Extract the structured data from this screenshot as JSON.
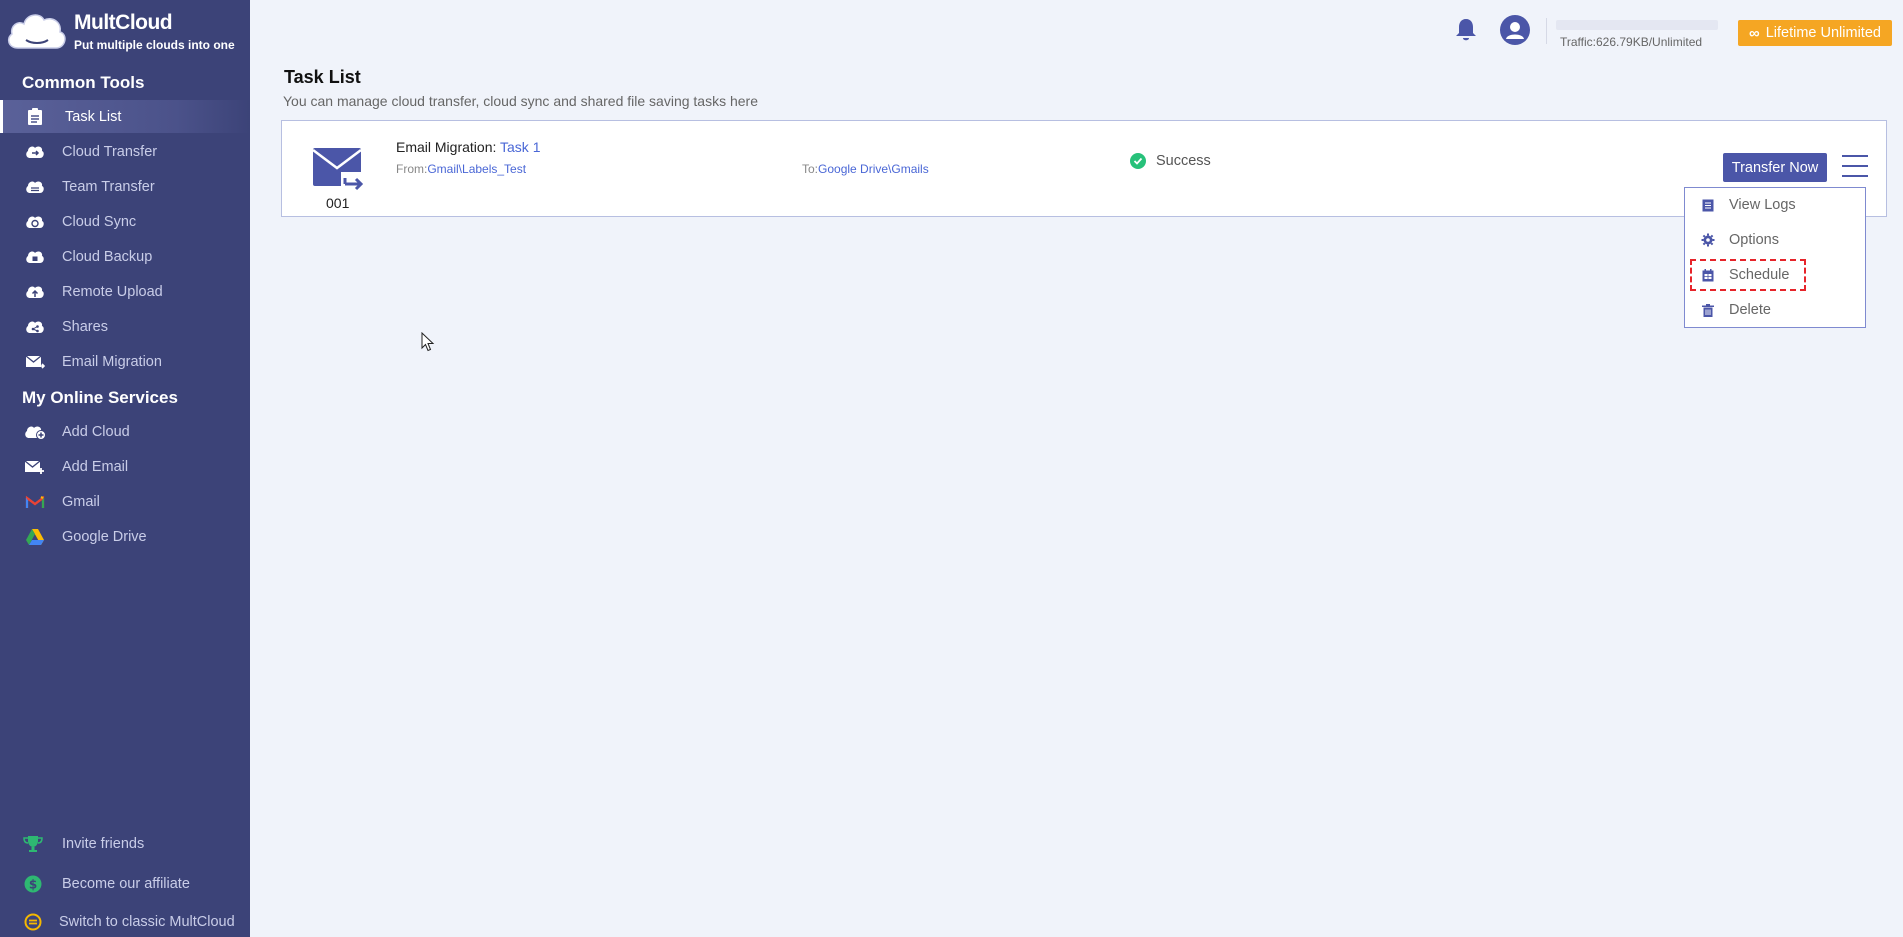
{
  "app": {
    "name": "MultCloud",
    "tagline": "Put multiple clouds into one"
  },
  "sidebar": {
    "common_tools_title": "Common Tools",
    "common_tools": [
      {
        "label": "Task List",
        "icon": "task-list-icon",
        "active": true
      },
      {
        "label": "Cloud Transfer",
        "icon": "cloud-transfer-icon"
      },
      {
        "label": "Team Transfer",
        "icon": "team-transfer-icon"
      },
      {
        "label": "Cloud Sync",
        "icon": "cloud-sync-icon"
      },
      {
        "label": "Cloud Backup",
        "icon": "cloud-backup-icon"
      },
      {
        "label": "Remote Upload",
        "icon": "remote-upload-icon"
      },
      {
        "label": "Shares",
        "icon": "shares-icon"
      },
      {
        "label": "Email Migration",
        "icon": "email-migration-icon"
      }
    ],
    "my_services_title": "My Online Services",
    "my_services": [
      {
        "label": "Add Cloud",
        "icon": "add-cloud-icon"
      },
      {
        "label": "Add Email",
        "icon": "add-email-icon"
      },
      {
        "label": "Gmail",
        "icon": "gmail-icon"
      },
      {
        "label": "Google Drive",
        "icon": "google-drive-icon"
      }
    ],
    "bottom": [
      {
        "label": "Invite friends",
        "icon": "trophy-icon"
      },
      {
        "label": "Become our affiliate",
        "icon": "dollar-icon"
      },
      {
        "label": "Switch to classic MultCloud",
        "icon": "switch-icon"
      }
    ]
  },
  "topbar": {
    "traffic": "Traffic:626.79KB/Unlimited",
    "lifetime_label": "Lifetime Unlimited",
    "colors": {
      "accent": "#4b56a8",
      "lifetime": "#f5a623",
      "sidebar": "#3c4378"
    }
  },
  "main": {
    "title": "Task List",
    "subtitle": "You can manage cloud transfer, cloud sync and shared file saving tasks here",
    "tasks": [
      {
        "number": "001",
        "type_prefix": "Email Migration:",
        "name": "Task 1",
        "from_prefix": "From:",
        "from_path": "Gmail\\Labels_Test",
        "to_prefix": "To:",
        "to_path": "Google Drive\\Gmails",
        "status": "Success",
        "action_label": "Transfer Now"
      }
    ],
    "menu": [
      {
        "label": "View Logs",
        "icon": "logs-icon"
      },
      {
        "label": "Options",
        "icon": "gear-icon"
      },
      {
        "label": "Schedule",
        "icon": "calendar-icon",
        "highlighted": true
      },
      {
        "label": "Delete",
        "icon": "trash-icon"
      }
    ]
  }
}
